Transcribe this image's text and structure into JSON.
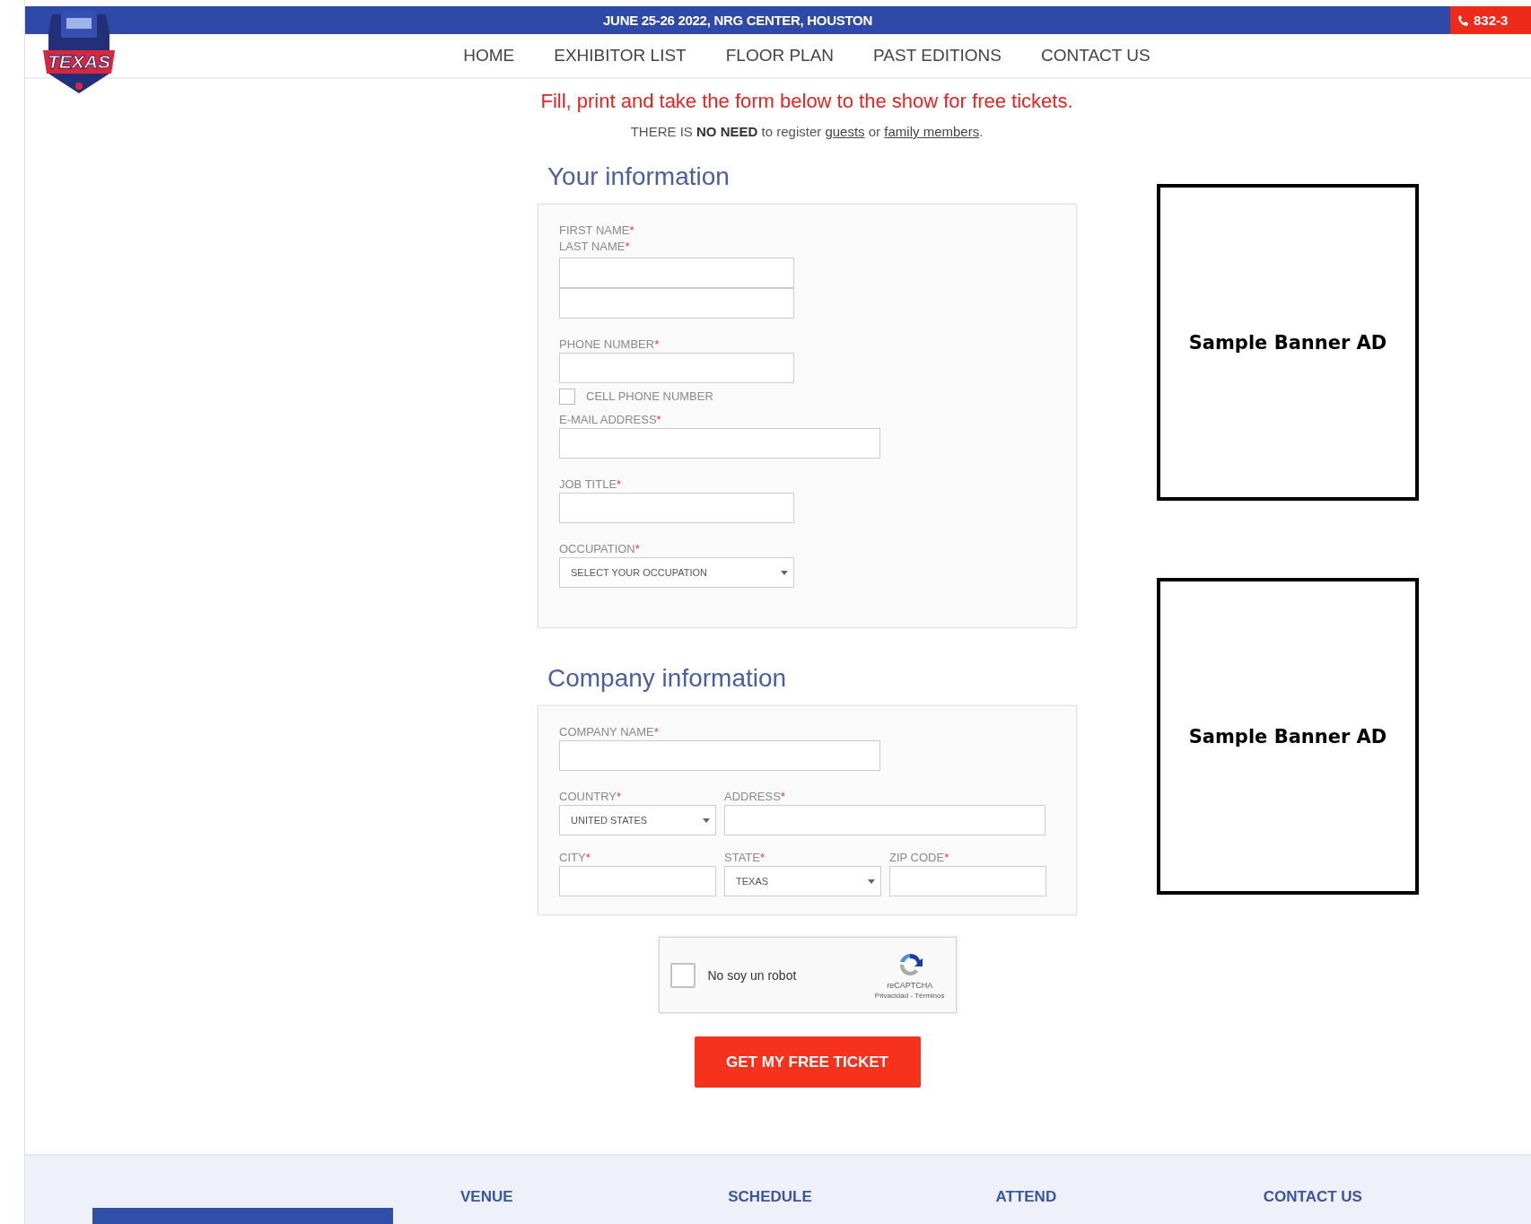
{
  "top_bar": {
    "event": "JUNE 25-26 2022, NRG CENTER, HOUSTON",
    "phone": "832-3"
  },
  "logo": {
    "text": "TEXAS"
  },
  "nav": [
    {
      "label": "HOME"
    },
    {
      "label": "EXHIBITOR LIST"
    },
    {
      "label": "FLOOR PLAN"
    },
    {
      "label": "PAST EDITIONS"
    },
    {
      "label": "CONTACT US"
    }
  ],
  "notice": "Fill, print and take the form below to the show for free tickets.",
  "note": [
    {
      "kind": "text",
      "text": "THERE IS **NO NEED** to register "
    },
    {
      "kind": "link",
      "text": "guests"
    },
    {
      "kind": "text",
      "text": " or "
    },
    {
      "kind": "link",
      "text": "family members"
    },
    {
      "kind": "text",
      "text": "."
    }
  ],
  "your_information": {
    "title": "Your information",
    "name_labels": [
      {
        "text": "FIRST NAME",
        "mark": "*"
      },
      {
        "text": "LAST NAME",
        "mark": "*"
      }
    ],
    "phone": {
      "text": "PHONE NUMBER",
      "mark": "*"
    },
    "cell_phone": {
      "label": "CELL PHONE NUMBER",
      "checked": false
    },
    "email": {
      "text": "E-MAIL ADDRESS",
      "mark": "*"
    },
    "job_title": {
      "text": "JOB TITLE",
      "mark": "*"
    },
    "occupation": {
      "label": {
        "text": "OCCUPATION",
        "mark": "*"
      },
      "value": "SELECT YOUR OCCUPATION"
    }
  },
  "company_information": {
    "title": "Company information",
    "company_name": {
      "text": "COMPANY NAME",
      "mark": "*"
    },
    "country": {
      "label": {
        "text": "COUNTRY",
        "mark": "*"
      },
      "value": "UNITED STATES"
    },
    "address": {
      "text": "ADDRESS",
      "mark": "*"
    },
    "city": {
      "text": "CITY",
      "mark": "*"
    },
    "state": {
      "label": {
        "text": "STATE",
        "mark": "*"
      },
      "value": "TEXAS"
    },
    "zip": {
      "text": "ZIP CODE",
      "mark": "*"
    }
  },
  "captcha": {
    "label": "No soy un robot",
    "checked": false,
    "brand": "reCAPTCHA",
    "links": "Privacidad - Términos"
  },
  "submit": "GET MY FREE TICKET",
  "ads": [
    "Sample Banner AD",
    "Sample Banner AD"
  ],
  "footer": [
    {
      "title": "VENUE"
    },
    {
      "title": "SCHEDULE"
    },
    {
      "title": "ATTEND"
    },
    {
      "title": "CONTACT US"
    }
  ]
}
